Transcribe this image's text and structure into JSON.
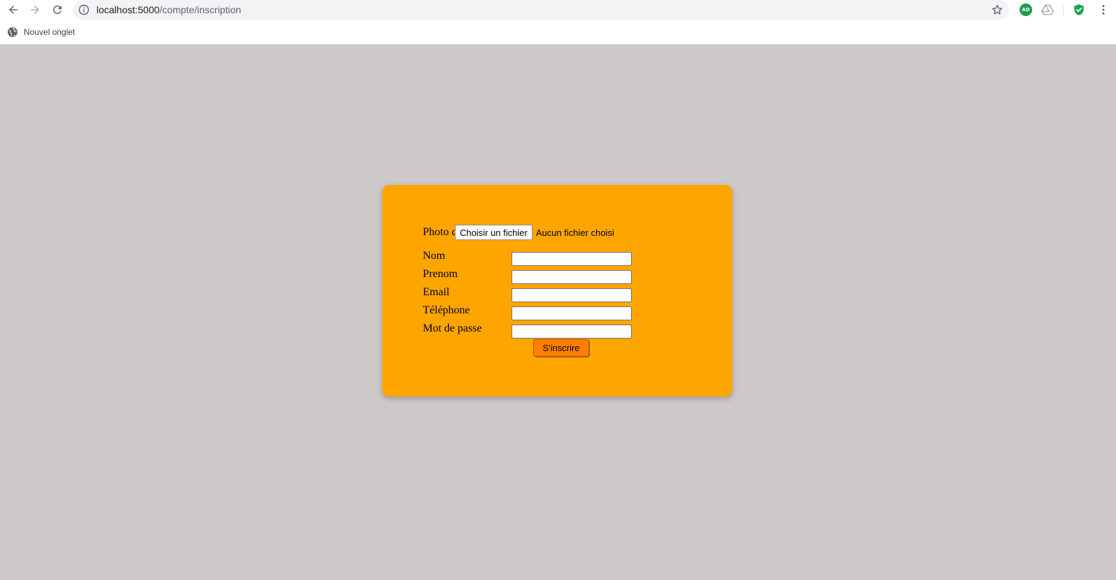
{
  "browser": {
    "url_host": "localhost:5000",
    "url_path": "/compte/inscription",
    "bookmark_label": "Nouvel onglet",
    "extension_ad_label": "AD",
    "icons": {
      "back": "arrow-left-icon",
      "forward": "arrow-right-icon",
      "reload": "reload-icon",
      "info": "info-icon",
      "star": "star-icon",
      "ad_extension": "adblock-icon",
      "drive_extension": "drive-icon",
      "shield_extension": "shield-check-icon",
      "menu": "kebab-menu-icon",
      "globe": "globe-icon"
    }
  },
  "form": {
    "photo_label": "Photo de profil",
    "file_button_label": "Choisir un fichier",
    "file_status": "Aucun fichier choisi",
    "fields": [
      {
        "label": "Nom",
        "value": ""
      },
      {
        "label": "Prenom",
        "value": ""
      },
      {
        "label": "Email",
        "value": ""
      },
      {
        "label": "Téléphone",
        "value": ""
      },
      {
        "label": "Mot de passe",
        "value": ""
      }
    ],
    "submit_label": "S'inscrire"
  },
  "colors": {
    "page_background": "#cdc9c8",
    "card_background": "#ffa500",
    "submit_background": "#ff7f00"
  }
}
